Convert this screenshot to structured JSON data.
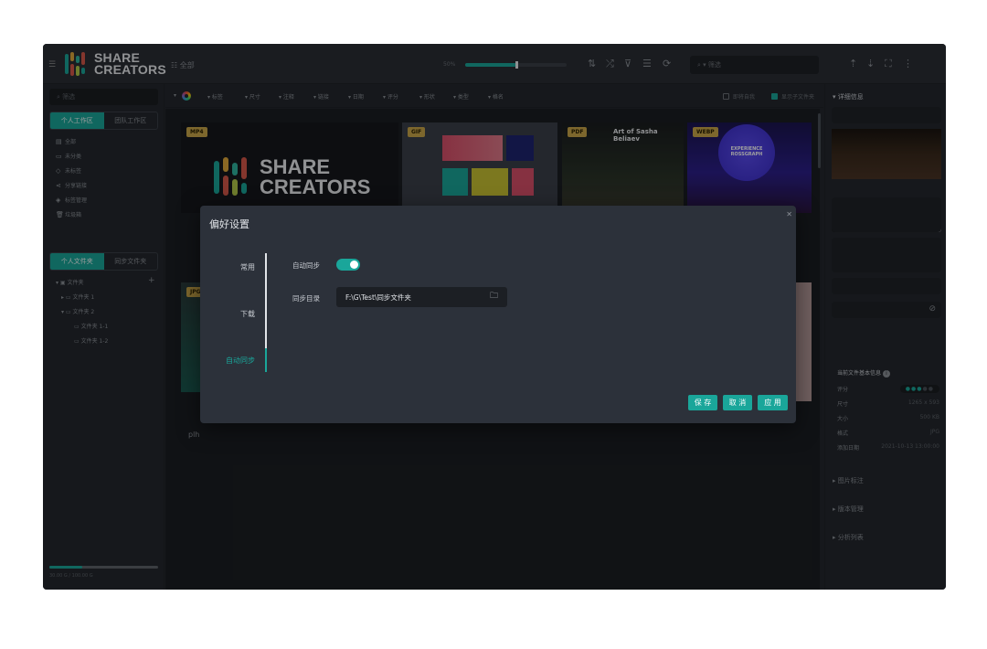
{
  "topbar": {
    "brand_line1": "SHARE",
    "brand_line2": "CREATORS",
    "all_label": "全部",
    "zoom": "50%",
    "zoom_fraction": 0.5,
    "search_placeholder": "筛选",
    "icons": [
      "sort-icon",
      "shuffle-icon",
      "filter-icon",
      "list-sort-icon",
      "refresh-icon",
      "upload-icon",
      "download-icon",
      "fullscreen-icon",
      "more-icon"
    ]
  },
  "left": {
    "search_placeholder": "筛选",
    "workspace_tabs": [
      "个人工作区",
      "团队工作区"
    ],
    "nav": [
      "全部",
      "未分类",
      "未标签",
      "分享链接",
      "标签管理",
      "垃圾箱"
    ],
    "folder_tabs": [
      "个人文件夹",
      "同步文件夹"
    ],
    "tree": {
      "root": "文件夹",
      "children": [
        "文件夹 1",
        "文件夹 2"
      ],
      "grandchildren": [
        "文件夹 1-1",
        "文件夹 1-2"
      ]
    },
    "storage_text": "30.00 G / 100.00 G",
    "storage_fraction": 0.3
  },
  "filterbar": {
    "items": [
      "标签",
      "尺寸",
      "注释",
      "链接",
      "日期",
      "评分",
      "形状",
      "类型",
      "格名"
    ],
    "check_left": "即将自我",
    "check_right": "显示子文件夹"
  },
  "grid": {
    "badges": [
      "MP4",
      "GIF",
      "PDF",
      "WEBP",
      "JPG"
    ],
    "pdf_title": "Art of Sasha Beliaev",
    "webp_text": "EXPERIENCE ROSSGRAPH",
    "partial_filename": "plh"
  },
  "right": {
    "title": "详细信息",
    "basic_info_title": "当前文件基本信息",
    "rows": [
      {
        "label": "评分",
        "value": ""
      },
      {
        "label": "尺寸",
        "value": "1265 x 593"
      },
      {
        "label": "大小",
        "value": "500 KB"
      },
      {
        "label": "格式",
        "value": "JPG"
      },
      {
        "label": "添加日期",
        "value": "2021-10-13 13:00:00"
      }
    ],
    "sections": [
      "图片标注",
      "版本管理",
      "分析列表"
    ],
    "swatches": [
      "#1a1a1a",
      "#3a2f28",
      "#8a5a3c",
      "#6e6a7a",
      "#8e8e94"
    ]
  },
  "dialog": {
    "title": "偏好设置",
    "tabs": [
      "常用",
      "下载",
      "自动同步"
    ],
    "auto_sync_label": "自动同步",
    "auto_sync_on": true,
    "sync_dir_label": "同步目录",
    "sync_dir_value": "F:\\G\\Test\\同步文件夹",
    "buttons": {
      "save": "保 存",
      "cancel": "取 消",
      "apply": "应 用"
    }
  }
}
